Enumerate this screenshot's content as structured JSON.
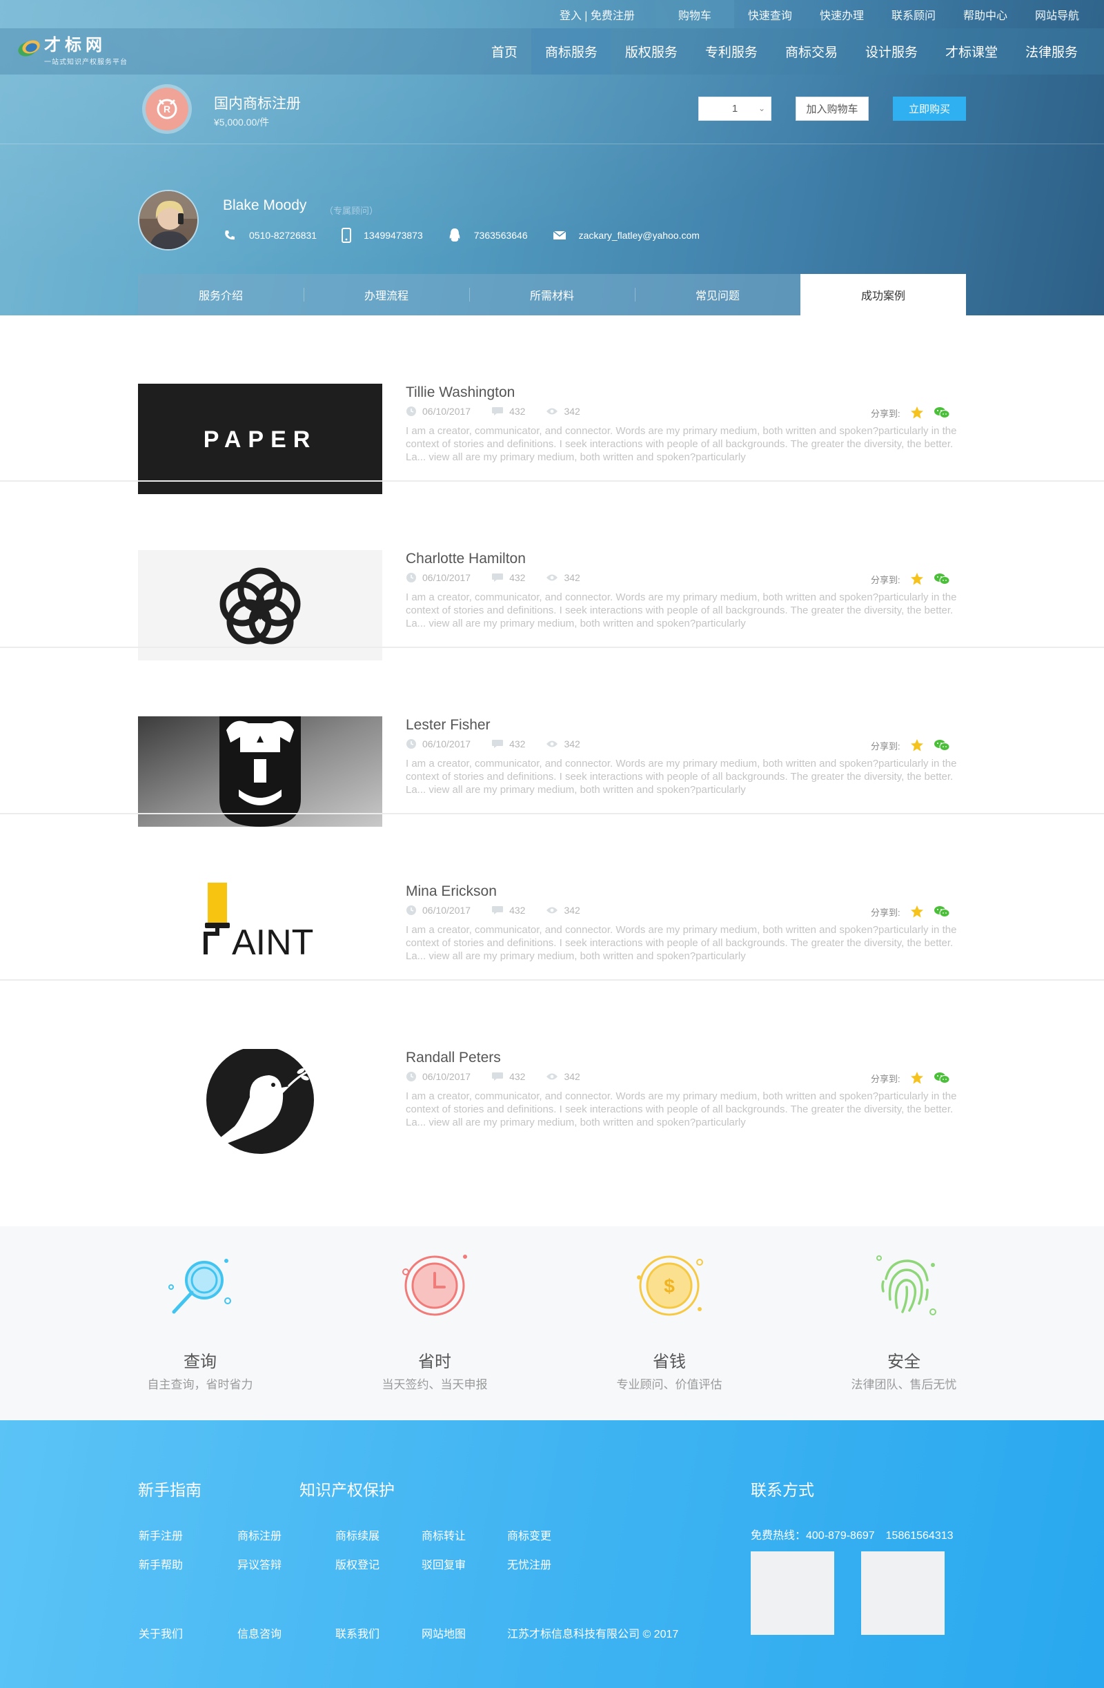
{
  "topbar": {
    "login": "登入 | 免费注册",
    "items": [
      "购物车",
      "快速查询",
      "快速办理",
      "联系顾问",
      "帮助中心",
      "网站导航"
    ]
  },
  "logo": {
    "title": "才标网",
    "subtitle": "一站式知识产权服务平台"
  },
  "nav": [
    "首页",
    "商标服务",
    "版权服务",
    "专利服务",
    "商标交易",
    "设计服务",
    "才标课堂",
    "法律服务"
  ],
  "nav_active": "商标服务",
  "product": {
    "name": "国内商标注册",
    "price": "¥5,000.00/件",
    "quantity": "1",
    "add_to_cart": "加入购物车",
    "buy_now": "立即购买"
  },
  "consultant": {
    "name": "Blake Moody",
    "role": "（专属顾问）",
    "phone": "0510-82726831",
    "mobile": "13499473873",
    "qq": "7363563646",
    "email": "zackary_flatley@yahoo.com"
  },
  "tabs": [
    "服务介绍",
    "办理流程",
    "所需材料",
    "常见问题",
    "成功案例"
  ],
  "tab_active": "成功案例",
  "cases": [
    {
      "title": "Tillie Washington",
      "date": "06/10/2017",
      "comments": "432",
      "views": "342",
      "share_label": "分享到:",
      "logo": "paper-logo",
      "desc": "I am a creator, communicator, and connector. Words are my primary medium, both written and spoken?particularly in the context of stories and definitions. I seek interactions with people of all backgrounds. The greater the diversity, the better. La... view all are my primary medium, both written and spoken?particularly"
    },
    {
      "title": "Charlotte Hamilton",
      "date": "06/10/2017",
      "comments": "432",
      "views": "342",
      "share_label": "分享到:",
      "logo": "knot-logo",
      "desc": "I am a creator, communicator, and connector. Words are my primary medium, both written and spoken?particularly in the context of stories and definitions. I seek interactions with people of all backgrounds. The greater the diversity, the better. La... view all are my primary medium, both written and spoken?particularly"
    },
    {
      "title": "Lester Fisher",
      "date": "06/10/2017",
      "comments": "432",
      "views": "342",
      "share_label": "分享到:",
      "logo": "viking-logo",
      "desc": "I am a creator, communicator, and connector. Words are my primary medium, both written and spoken?particularly in the context of stories and definitions. I seek interactions with people of all backgrounds. The greater the diversity, the better. La... view all are my primary medium, both written and spoken?particularly"
    },
    {
      "title": "Mina Erickson",
      "date": "06/10/2017",
      "comments": "432",
      "views": "342",
      "share_label": "分享到:",
      "logo": "paint-logo",
      "desc": "I am a creator, communicator, and connector. Words are my primary medium, both written and spoken?particularly in the context of stories and definitions. I seek interactions with people of all backgrounds. The greater the diversity, the better. La... view all are my primary medium, both written and spoken?particularly"
    },
    {
      "title": "Randall Peters",
      "date": "06/10/2017",
      "comments": "432",
      "views": "342",
      "share_label": "分享到:",
      "logo": "dove-logo",
      "desc": "I am a creator, communicator, and connector. Words are my primary medium, both written and spoken?particularly in the context of stories and definitions. I seek interactions with people of all backgrounds. The greater the diversity, the better. La... view all are my primary medium, both written and spoken?particularly"
    }
  ],
  "paper_logo_text": "PAPER",
  "paint_logo_text": "AINT",
  "features": [
    {
      "title": "查询",
      "sub": "自主查询，省时省力",
      "icon": "magnifier-icon",
      "color": "#42c4f0"
    },
    {
      "title": "省时",
      "sub": "当天签约、当天申报",
      "icon": "clock-icon",
      "color": "#f07b78"
    },
    {
      "title": "省钱",
      "sub": "专业顾问、价值评估",
      "icon": "coin-icon",
      "color": "#f6c945"
    },
    {
      "title": "安全",
      "sub": "法律团队、售后无忧",
      "icon": "fingerprint-icon",
      "color": "#8fd67a"
    }
  ],
  "footer": {
    "guide_heading": "新手指南",
    "ip_heading": "知识产权保护",
    "contact_heading": "联系方式",
    "hotline": "免费热线：400-879-8697　15861564313",
    "row1": [
      "新手注册",
      "商标注册",
      "商标续展",
      "商标转让",
      "商标变更"
    ],
    "row2": [
      "新手帮助",
      "异议答辩",
      "版权登记",
      "驳回复审",
      "无忧注册"
    ],
    "row3": [
      "关于我们",
      "信息咨询",
      "联系我们",
      "网站地图",
      "江苏才标信息科技有限公司 © 2017"
    ]
  },
  "colors": {
    "accent": "#2fb0f0",
    "star": "#f6c21c",
    "wechat": "#4cbf3a"
  }
}
